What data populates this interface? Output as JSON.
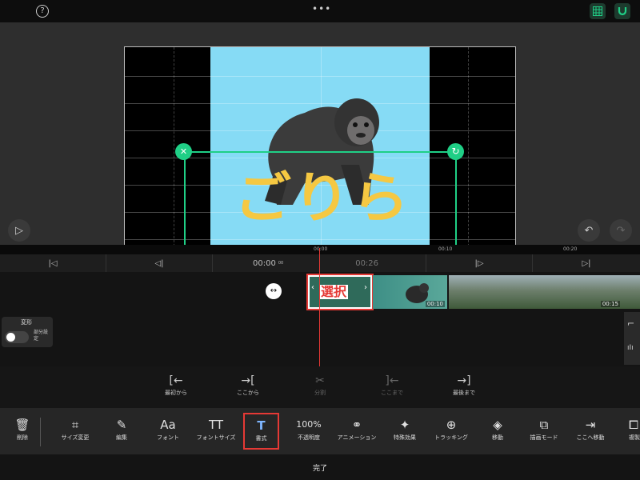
{
  "topbar": {
    "help_icon": "question-circle-icon",
    "more_icon": "ellipsis-icon",
    "grid_icon": "grid-icon",
    "magnet_icon": "magnet-icon",
    "accent": "#1fcf86"
  },
  "preview": {
    "overlay_text": "ごりら",
    "text_color": "#f5c842",
    "sky_color": "#86dbf5",
    "handle_color": "#1fcf86"
  },
  "ruler": {
    "marks": [
      "00:00",
      "00:10",
      "00:20"
    ]
  },
  "transport": {
    "time": "00:00",
    "time_frames": "00",
    "duration": "00:26"
  },
  "timeline": {
    "selection_label": "選択",
    "clip1_duration": "00:10",
    "clip2_duration": "00:15"
  },
  "transform": {
    "label": "変形",
    "toggle_label": "部分設定"
  },
  "ops": [
    {
      "label": "最初から",
      "icon": "trim-start-icon"
    },
    {
      "label": "ここから",
      "icon": "trim-here-icon"
    },
    {
      "label": "分割",
      "icon": "split-icon"
    },
    {
      "label": "ここまで",
      "icon": "trim-to-here-icon"
    },
    {
      "label": "最後まで",
      "icon": "trim-end-icon"
    }
  ],
  "tools": [
    {
      "label": "削除",
      "icon": "trash-icon"
    },
    {
      "label": "サイズ変更",
      "icon": "crop-icon"
    },
    {
      "label": "編集",
      "icon": "pencil-icon"
    },
    {
      "label": "フォント",
      "icon": "font-icon"
    },
    {
      "label": "フォントサイズ",
      "icon": "font-size-icon"
    },
    {
      "label": "書式",
      "icon": "text-style-icon"
    },
    {
      "label": "不透明度",
      "value": "100%"
    },
    {
      "label": "アニメーション",
      "icon": "animation-icon"
    },
    {
      "label": "特殊効果",
      "icon": "magic-wand-icon"
    },
    {
      "label": "トラッキング",
      "icon": "tracking-icon"
    },
    {
      "label": "移動",
      "icon": "layers-icon"
    },
    {
      "label": "描画モード",
      "icon": "blend-mode-icon"
    },
    {
      "label": "ここへ移動",
      "icon": "move-here-icon"
    },
    {
      "label": "複製",
      "icon": "duplicate-icon"
    }
  ],
  "done_label": "完了",
  "highlight_color": "#e53935"
}
